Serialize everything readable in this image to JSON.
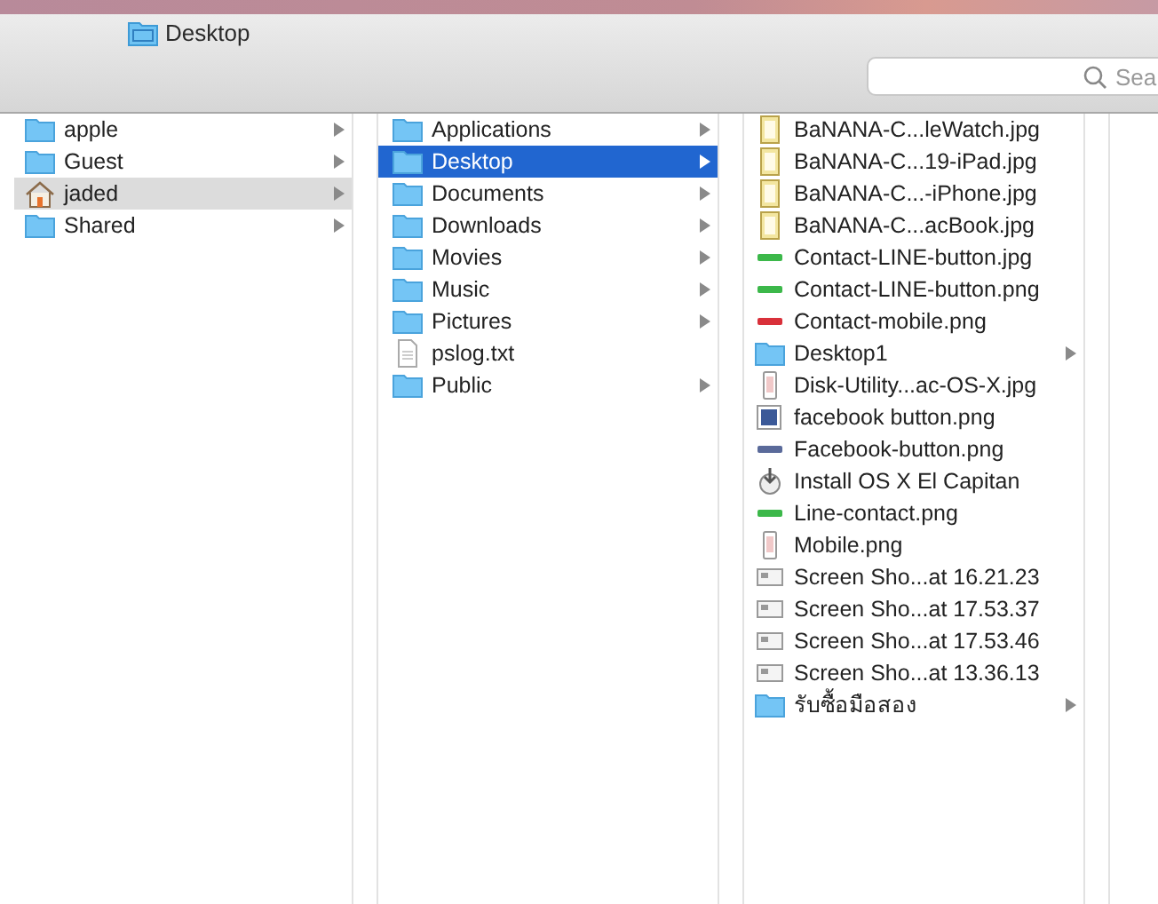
{
  "window": {
    "title": "Desktop"
  },
  "search": {
    "placeholder": "Sea"
  },
  "columns": [
    {
      "active": false,
      "items": [
        {
          "name": "apple",
          "kind": "folder",
          "has_children": true,
          "selected": false
        },
        {
          "name": "Guest",
          "kind": "folder",
          "has_children": true,
          "selected": false
        },
        {
          "name": "jaded",
          "kind": "home",
          "has_children": true,
          "selected": true
        },
        {
          "name": "Shared",
          "kind": "folder",
          "has_children": true,
          "selected": false
        }
      ]
    },
    {
      "active": true,
      "items": [
        {
          "name": "Applications",
          "kind": "folder",
          "has_children": true,
          "selected": false
        },
        {
          "name": "Desktop",
          "kind": "folder",
          "has_children": true,
          "selected": true
        },
        {
          "name": "Documents",
          "kind": "folder",
          "has_children": true,
          "selected": false
        },
        {
          "name": "Downloads",
          "kind": "folder",
          "has_children": true,
          "selected": false
        },
        {
          "name": "Movies",
          "kind": "folder",
          "has_children": true,
          "selected": false
        },
        {
          "name": "Music",
          "kind": "folder",
          "has_children": true,
          "selected": false
        },
        {
          "name": "Pictures",
          "kind": "folder",
          "has_children": true,
          "selected": false
        },
        {
          "name": "pslog.txt",
          "kind": "document",
          "has_children": false,
          "selected": false
        },
        {
          "name": "Public",
          "kind": "folder",
          "has_children": true,
          "selected": false
        }
      ]
    },
    {
      "items": [
        {
          "name": "BaNANA-C...leWatch.jpg",
          "kind": "poster",
          "has_children": false,
          "selected": false
        },
        {
          "name": "BaNANA-C...19-iPad.jpg",
          "kind": "poster",
          "has_children": false,
          "selected": false
        },
        {
          "name": "BaNANA-C...-iPhone.jpg",
          "kind": "poster",
          "has_children": false,
          "selected": false
        },
        {
          "name": "BaNANA-C...acBook.jpg",
          "kind": "poster",
          "has_children": false,
          "selected": false
        },
        {
          "name": "Contact-LINE-button.jpg",
          "kind": "bar",
          "color": "#3cb84a",
          "has_children": false,
          "selected": false
        },
        {
          "name": "Contact-LINE-button.png",
          "kind": "bar",
          "color": "#3cb84a",
          "has_children": false,
          "selected": false
        },
        {
          "name": "Contact-mobile.png",
          "kind": "bar",
          "color": "#d9303a",
          "has_children": false,
          "selected": false
        },
        {
          "name": "Desktop1",
          "kind": "folder",
          "has_children": true,
          "selected": false
        },
        {
          "name": "Disk-Utility...ac-OS-X.jpg",
          "kind": "phone",
          "has_children": false,
          "selected": false
        },
        {
          "name": "facebook button.png",
          "kind": "facebook",
          "has_children": false,
          "selected": false
        },
        {
          "name": "Facebook-button.png",
          "kind": "bar",
          "color": "#5a6a9a",
          "has_children": false,
          "selected": false
        },
        {
          "name": "Install OS X El Capitan",
          "kind": "installer",
          "has_children": false,
          "selected": false
        },
        {
          "name": "Line-contact.png",
          "kind": "bar",
          "color": "#3cb84a",
          "has_children": false,
          "selected": false
        },
        {
          "name": "Mobile.png",
          "kind": "phone",
          "has_children": false,
          "selected": false
        },
        {
          "name": "Screen Sho...at 16.21.23",
          "kind": "screenshot",
          "has_children": false,
          "selected": false
        },
        {
          "name": "Screen Sho...at 17.53.37",
          "kind": "screenshot",
          "has_children": false,
          "selected": false
        },
        {
          "name": "Screen Sho...at 17.53.46",
          "kind": "screenshot",
          "has_children": false,
          "selected": false
        },
        {
          "name": "Screen Sho...at 13.36.13",
          "kind": "screenshot",
          "has_children": false,
          "selected": false
        },
        {
          "name": "รับซื้อมือสอง",
          "kind": "folder",
          "has_children": true,
          "selected": false
        }
      ]
    }
  ]
}
